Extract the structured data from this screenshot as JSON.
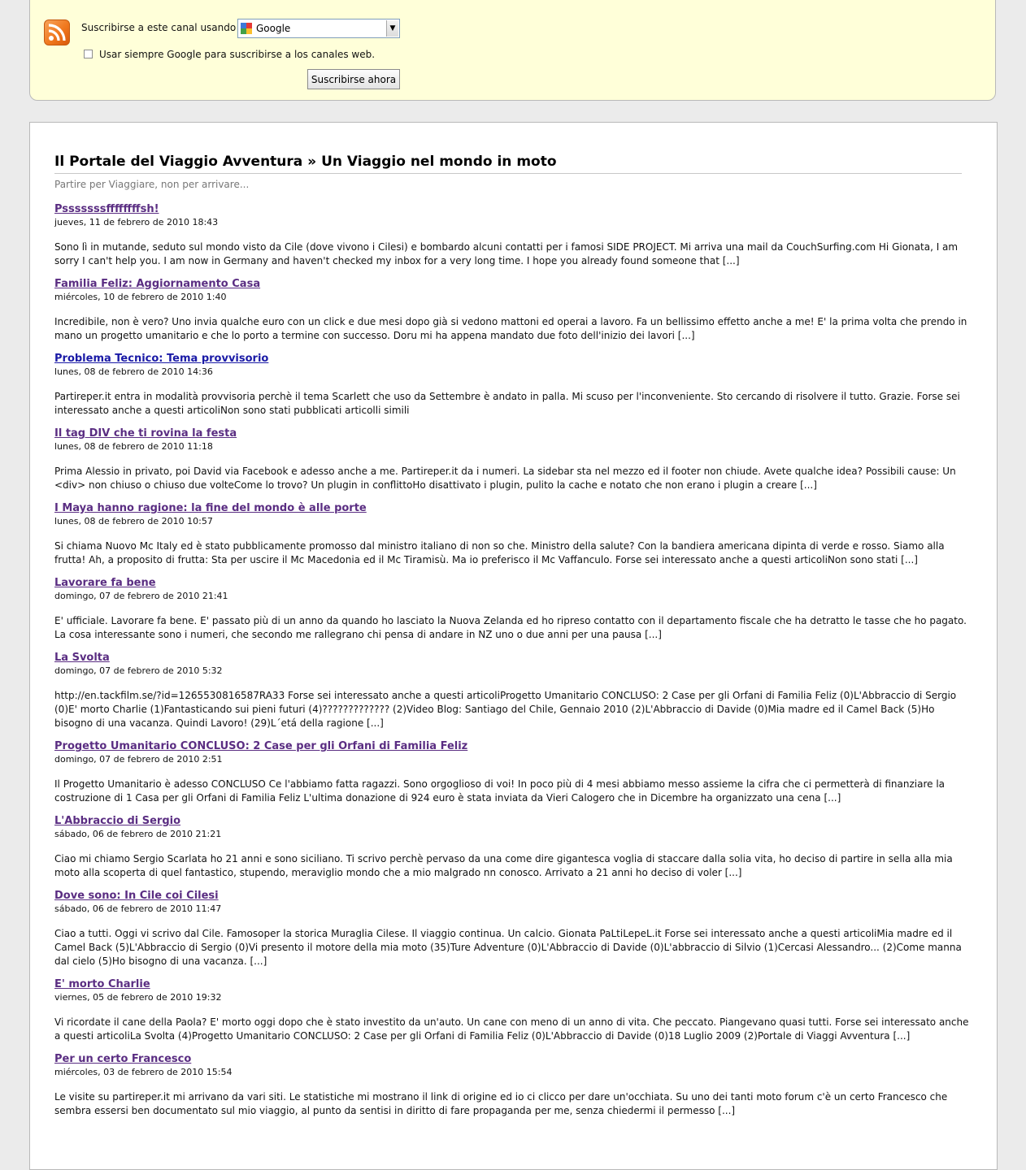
{
  "subscribe": {
    "label": "Suscribirse a este canal usando",
    "selected_reader": "Google",
    "checkbox_label": "Usar siempre Google para suscribirse a los canales web.",
    "checkbox_checked": false,
    "button_label": "Suscribirse ahora",
    "rss_icon": "rss-feed-icon"
  },
  "feed": {
    "title": "Il Portale del Viaggio Avventura » Un Viaggio nel mondo in moto",
    "subtitle": "Partire per Viaggiare, non per arrivare...",
    "entries": [
      {
        "title": "Psssssssffffffffsh!",
        "date": "jueves, 11 de febrero de 2010 18:43",
        "text": "Sono lì in mutande, seduto sul mondo visto da Cile (dove vivono i Cilesi) e bombardo alcuni contatti per i famosi SIDE PROJECT. Mi arriva una mail da CouchSurfing.com Hi Gionata, I am sorry I can't help you. I am now in Germany and haven't checked my inbox for a very long time. I hope you already found someone that [...]"
      },
      {
        "title": "Familia Feliz: Aggiornamento Casa",
        "date": "miércoles, 10 de febrero de 2010 1:40",
        "text": "Incredibile, non è vero? Uno invia qualche euro con un click e due mesi dopo già si vedono mattoni ed operai a lavoro. Fa un bellissimo effetto anche a me! E' la prima volta che prendo in mano un progetto umanitario e che lo porto a termine con successo. Doru mi ha appena mandato due foto dell'inizio dei lavori [...]"
      },
      {
        "title": "Problema Tecnico: Tema provvisorio",
        "date": "lunes, 08 de febrero de 2010 14:36",
        "text": "Partireper.it entra in modalità provvisoria perchè il tema Scarlett che uso da Settembre è andato in palla. Mi scuso per l'inconveniente. Sto cercando di risolvere il tutto. Grazie. Forse sei interessato anche a questi articoliNon sono stati pubblicati articolli simili"
      },
      {
        "title": "Il tag DIV che ti rovina la festa",
        "date": "lunes, 08 de febrero de 2010 11:18",
        "text": "Prima Alessio in privato, poi David via Facebook e adesso anche a me. Partireper.it da i numeri. La sidebar sta nel mezzo ed il footer non chiude. Avete qualche idea? Possibili cause: Un <div> non chiuso o chiuso due volteCome lo trovo? Un plugin in conflittoHo disattivato i plugin, pulito la cache e notato che non erano i plugin a creare [...]"
      },
      {
        "title": "I Maya hanno ragione: la fine del mondo è alle porte",
        "date": "lunes, 08 de febrero de 2010 10:57",
        "text": "Si chiama Nuovo Mc Italy ed è stato pubblicamente promosso dal ministro italiano di non so che. Ministro della salute? Con la bandiera americana dipinta di verde e rosso. Siamo alla frutta! Ah, a proposito di frutta: Sta per uscire il Mc Macedonia ed il Mc Tiramisù. Ma io preferisco il Mc Vaffanculo. Forse sei interessato anche a questi articoliNon sono stati [...]"
      },
      {
        "title": "Lavorare fa bene",
        "date": "domingo, 07 de febrero de 2010 21:41",
        "text": "E' ufficiale. Lavorare fa bene. E' passato più di un anno da quando ho lasciato la Nuova Zelanda ed ho ripreso contatto con il departamento fiscale che ha detratto le tasse che ho pagato. La cosa interessante sono i numeri, che secondo me rallegrano chi pensa di andare in NZ uno o due anni per una pausa [...]"
      },
      {
        "title": "La Svolta",
        "date": "domingo, 07 de febrero de 2010 5:32",
        "text": "http://en.tackfilm.se/?id=1265530816587RA33 Forse sei interessato anche a questi articoliProgetto Umanitario CONCLUSO: 2 Case per gli Orfani di Familia Feliz (0)L'Abbraccio di Sergio (0)E' morto Charlie (1)Fantasticando sui pieni futuri (4)????????????? (2)Video Blog: Santiago del Chile, Gennaio 2010 (2)L'Abbraccio di Davide (0)Mia madre ed il Camel Back (5)Ho bisogno di una vacanza. Quindi Lavoro! (29)L´etá della ragione [...]"
      },
      {
        "title": "Progetto Umanitario CONCLUSO: 2 Case per gli Orfani di Familia Feliz",
        "date": "domingo, 07 de febrero de 2010 2:51",
        "text": "Il Progetto Umanitario è adesso CONCLUSO Ce l'abbiamo fatta ragazzi. Sono orgoglioso di voi! In poco più di 4 mesi abbiamo messo assieme la cifra che ci permetterà di finanziare la costruzione di 1 Casa per gli Orfani di Familia Feliz L'ultima donazione di 924 euro è stata inviata da Vieri Calogero che in Dicembre ha organizzato una cena [...]"
      },
      {
        "title": "L'Abbraccio di Sergio",
        "date": "sábado, 06 de febrero de 2010 21:21",
        "text": "Ciao mi chiamo Sergio Scarlata ho 21 anni e sono siciliano. Ti scrivo perchè pervaso da una come dire gigantesca voglia di staccare dalla solia vita, ho deciso di partire in sella alla mia moto alla scoperta di quel fantastico, stupendo, meraviglio mondo che a mio malgrado nn conosco. Arrivato a 21 anni ho deciso di voler [...]"
      },
      {
        "title": "Dove sono: In Cile coi Cilesi",
        "date": "sábado, 06 de febrero de 2010 11:47",
        "text": "Ciao a tutti. Oggi vi scrivo dal Cile. Famosoper la storica Muraglia Cilese. Il viaggio continua. Un calcio. Gionata PaLtiLepeL.it Forse sei interessato anche a questi articoliMia madre ed il Camel Back (5)L'Abbraccio di Sergio (0)Vi presento il motore della mia moto (35)Ture Adventure (0)L'Abbraccio di Davide (0)L'abbraccio di Silvio (1)Cercasi Alessandro... (2)Come manna dal cielo (5)Ho bisogno di una vacanza. [...]"
      },
      {
        "title": "E' morto Charlie",
        "date": "viernes, 05 de febrero de 2010 19:32",
        "text": "Vi ricordate il cane della Paola? E' morto oggi dopo che è stato investito da un'auto. Un cane con meno di un anno di vita. Che peccato. Piangevano quasi tutti. Forse sei interessato anche a questi articoliLa Svolta (4)Progetto Umanitario CONCLUSO: 2 Case per gli Orfani di Familia Feliz (0)L'Abbraccio di Davide (0)18 Luglio 2009 (2)Portale di Viaggi Avventura [...]"
      },
      {
        "title": "Per un certo Francesco",
        "date": "miércoles, 03 de febrero de 2010 15:54",
        "text": "Le visite su partireper.it mi arrivano da vari siti. Le statistiche mi mostrano il link di origine ed io ci clicco per dare un'occhiata. Su uno dei tanti moto forum c'è un certo Francesco che sembra essersi ben documentato sul mio viaggio, al punto da sentisi in diritto di fare propaganda per me, senza chiedermi il permesso [...]"
      }
    ]
  }
}
